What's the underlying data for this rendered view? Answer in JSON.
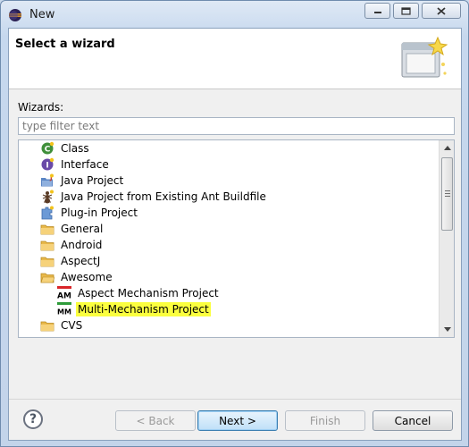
{
  "window": {
    "title": "New"
  },
  "header": {
    "title": "Select a wizard"
  },
  "wizards_label": "Wizards:",
  "filter": {
    "placeholder": "type filter text",
    "value": ""
  },
  "tree": {
    "items": [
      {
        "label": "Class",
        "icon": "class-icon",
        "level": 0
      },
      {
        "label": "Interface",
        "icon": "interface-icon",
        "level": 0
      },
      {
        "label": "Java Project",
        "icon": "java-project-icon",
        "level": 0
      },
      {
        "label": "Java Project from Existing Ant Buildfile",
        "icon": "ant-project-icon",
        "level": 0
      },
      {
        "label": "Plug-in Project",
        "icon": "plugin-project-icon",
        "level": 0
      },
      {
        "label": "General",
        "icon": "folder-icon",
        "level": 0
      },
      {
        "label": "Android",
        "icon": "folder-icon",
        "level": 0
      },
      {
        "label": "AspectJ",
        "icon": "folder-icon",
        "level": 0
      },
      {
        "label": "Awesome",
        "icon": "folder-open-icon",
        "level": 0
      },
      {
        "label": "Aspect Mechanism Project",
        "icon": "am-icon",
        "icon_text": "AM",
        "level": 1
      },
      {
        "label": "Multi-Mechanism Project",
        "icon": "mm-icon",
        "icon_text": "MM",
        "level": 1,
        "highlighted": true
      },
      {
        "label": "CVS",
        "icon": "folder-icon",
        "level": 0
      }
    ]
  },
  "buttons": {
    "back": "< Back",
    "next": "Next >",
    "finish": "Finish",
    "cancel": "Cancel"
  },
  "colors": {
    "highlight": "#fbff3f",
    "folder": "#e8b84a",
    "accent": "#3c7fb1"
  }
}
